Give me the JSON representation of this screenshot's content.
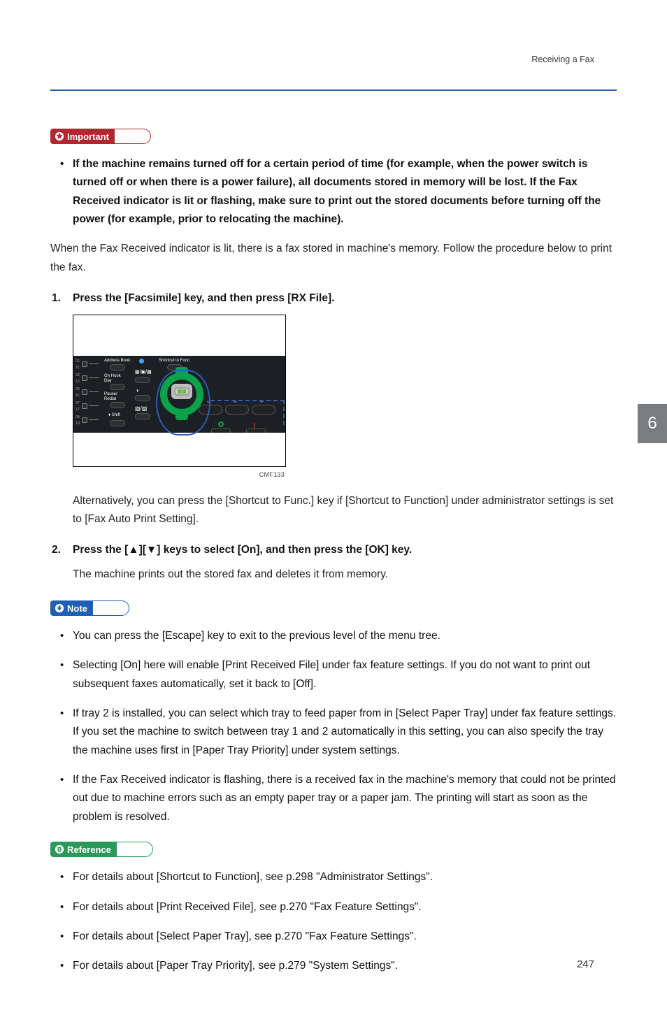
{
  "header": {
    "running_title": "Receiving a Fax"
  },
  "side_tab": "6",
  "page_number": "247",
  "callouts": {
    "important_label": "Important",
    "note_label": "Note",
    "reference_label": "Reference"
  },
  "important": {
    "items": [
      "If the machine remains turned off for a certain period of time (for example, when the power switch is turned off or when there is a power failure), all documents stored in memory will be lost. If the Fax Received indicator is lit or flashing, make sure to print out the stored documents before turning off the power (for example, prior to relocating the machine)."
    ]
  },
  "intro_paragraph": "When the Fax Received indicator is lit, there is a fax stored in machine's memory. Follow the procedure below to print the fax.",
  "steps": [
    {
      "num": "1.",
      "heading": "Press the [Facsimile] key, and then press [RX File].",
      "after_figure_text": "Alternatively, you can press the [Shortcut to Func.] key if [Shortcut to Function] under administrator settings is set to [Fax Auto Print Setting].",
      "figure_caption": "CMF133"
    },
    {
      "num": "2.",
      "heading": "Press the [▲][▼] keys to select [On], and then press the [OK] key.",
      "body": "The machine prints out the stored fax and deletes it from memory."
    }
  ],
  "notes": [
    "You can press the [Escape] key to exit to the previous level of the menu tree.",
    "Selecting [On] here will enable [Print Received File] under fax feature settings. If you do not want to print out subsequent faxes automatically, set it back to [Off].",
    "If tray 2 is installed, you can select which tray to feed paper from in [Select Paper Tray] under fax feature settings. If you set the machine to switch between tray 1 and 2 automatically in this setting, you can also specify the tray the machine uses first in [Paper Tray Priority] under system settings.",
    "If the Fax Received indicator is flashing, there is a received fax in the machine's memory that could not be printed out due to machine errors such as an empty paper tray or a paper jam. The printing will start as soon as the problem is resolved."
  ],
  "references": [
    "For details about [Shortcut to Function], see p.298 \"Administrator Settings\".",
    "For details about [Print Received File], see p.270 \"Fax Feature Settings\".",
    "For details about [Select Paper Tray], see p.270 \"Fax Feature Settings\".",
    "For details about [Paper Tray Priority], see p.279 \"System Settings\"."
  ],
  "panel_labels": {
    "address_book": "Address Book",
    "on_hook": "On Hook\nDial",
    "pause_redial": "Pause/\nRedial",
    "shift": "Shift",
    "shortcut": "Shortcut to Func."
  }
}
